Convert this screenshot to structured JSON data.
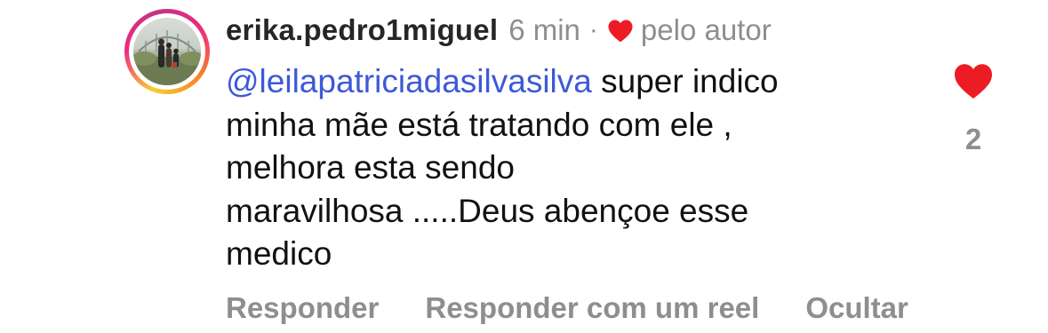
{
  "comment": {
    "username": "erika.pedro1miguel",
    "time": "6 min",
    "separator": "·",
    "liked_by_author_label": "pelo autor",
    "mention": "@leilapatriciadasilvasilva",
    "lines": [
      " super indico",
      "minha mãe está tratando com ele ,",
      "melhora esta sendo",
      "maravilhosa .....Deus abençoe esse",
      "medico"
    ],
    "like_count": "2",
    "actions": {
      "reply": "Responder",
      "reply_with_reel": "Responder com um reel",
      "hide": "Ocultar"
    }
  },
  "colors": {
    "heart": "#ed1c24",
    "mention": "#3d59d8",
    "muted": "#8e8e8e",
    "text": "#111111"
  },
  "icons": {
    "author_like": "heart-icon",
    "like_button": "heart-icon"
  }
}
